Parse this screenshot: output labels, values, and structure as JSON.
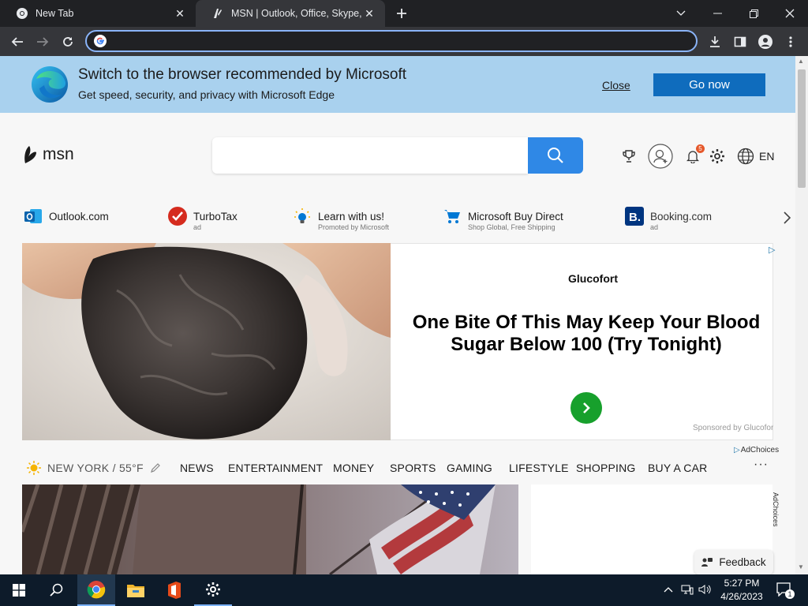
{
  "browser": {
    "tabs": [
      {
        "title": "New Tab",
        "active": false
      },
      {
        "title": "MSN | Outlook, Office, Skype, Bing",
        "active": true
      }
    ],
    "address": {
      "value": ""
    }
  },
  "banner": {
    "headline": "Switch to the browser recommended by Microsoft",
    "subtext": "Get speed, security, and privacy with Microsoft Edge",
    "close_label": "Close",
    "go_label": "Go now"
  },
  "header": {
    "logo_text": "msn",
    "search": {
      "value": "",
      "placeholder": ""
    },
    "notification_count": "5",
    "language": "EN"
  },
  "quick_links": [
    {
      "name": "Outlook.com",
      "sub": "",
      "icon": "outlook-icon"
    },
    {
      "name": "TurboTax",
      "sub": "ad",
      "icon": "turbotax-icon"
    },
    {
      "name": "Learn with us!",
      "sub": "Promoted by Microsoft",
      "icon": "lightbulb-icon"
    },
    {
      "name": "Microsoft Buy Direct",
      "sub": "Shop Global, Free Shipping",
      "icon": "cart-icon"
    },
    {
      "name": "Booking.com",
      "sub": "ad",
      "icon": "booking-icon"
    }
  ],
  "ad": {
    "brand": "Glucofort",
    "headline": "One Bite Of This May Keep Your Blood Sugar Below 100 (Try Tonight)",
    "sponsor": "Sponsored by Glucofort",
    "adchoices": "AdChoices"
  },
  "nav": {
    "weather": "NEW YORK / 55°F",
    "items": [
      "NEWS",
      "ENTERTAINMENT",
      "MONEY",
      "SPORTS",
      "GAMING",
      "LIFESTYLE",
      "SHOPPING",
      "BUY A CAR"
    ],
    "more": "···"
  },
  "sidecard": {
    "adchoices": "AdChoices"
  },
  "feedback_label": "Feedback",
  "taskbar": {
    "time": "5:27 PM",
    "date": "4/26/2023",
    "notifications": "1"
  },
  "colors": {
    "banner_bg": "#a9d1ee",
    "go_button": "#0f6cbd",
    "search_button": "#2f88e6",
    "ad_green": "#17a02c"
  }
}
